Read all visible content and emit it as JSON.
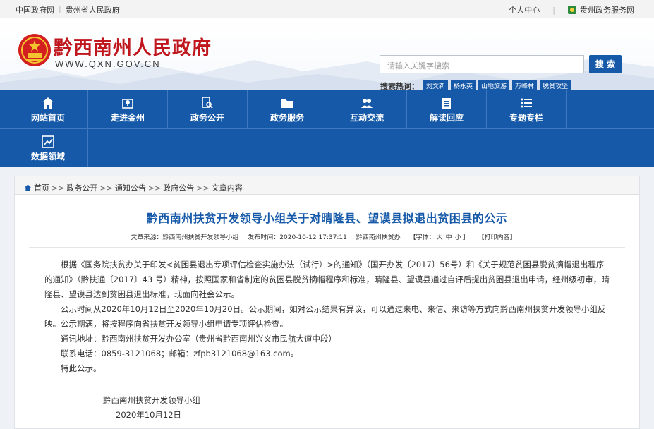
{
  "topbar": {
    "left_links": [
      "中国政府网",
      "贵州省人民政府"
    ],
    "personal_center": "个人中心",
    "gz_service": "贵州政务服务网"
  },
  "header": {
    "site_title": "黔西南州人民政府",
    "site_url": "WWW.QXN.GOV.CN",
    "search_placeholder": "请输入关键字搜索",
    "search_button": "搜 索",
    "hotwords_label": "搜索热词：",
    "hotwords": [
      "刘文新",
      "杨永英",
      "山地旅游",
      "万峰林",
      "脱贫攻坚"
    ]
  },
  "nav": {
    "items": [
      {
        "label": "网站首页",
        "icon": "home-icon"
      },
      {
        "label": "走进金州",
        "icon": "map-pin-icon"
      },
      {
        "label": "政务公开",
        "icon": "document-search-icon"
      },
      {
        "label": "政务服务",
        "icon": "folder-icon"
      },
      {
        "label": "互动交流",
        "icon": "people-icon"
      },
      {
        "label": "解读回应",
        "icon": "clipboard-icon"
      },
      {
        "label": "专题专栏",
        "icon": "list-icon"
      },
      {
        "label": "数据领域",
        "icon": "chart-icon"
      }
    ]
  },
  "breadcrumb": {
    "items": [
      "首页",
      "政务公开",
      "通知公告",
      "政府公告",
      "文章内容"
    ],
    "sep": ">>"
  },
  "article": {
    "title": "黔西南州扶贫开发领导小组关于对晴隆县、望谟县拟退出贫困县的公示",
    "meta_source": "文章来源：黔西南州扶贫开发领导小组",
    "meta_time": "发布时间：2020-10-12 17:37:11",
    "meta_author": "黔西南州扶贫办",
    "meta_font_prefix": "【字体：",
    "meta_font_sizes": [
      "大",
      "中",
      "小"
    ],
    "meta_font_suffix": "】",
    "meta_print": "【打印内容】",
    "paragraphs": [
      "根据《国务院扶贫办关于印发<贫困县退出专项评估检查实施办法（试行）>的通知》（国开办发〔2017〕56号）和《关于规范贫困县脱贫摘帽退出程序的通知》（黔扶通〔2017〕43 号）精神，按照国家和省制定的贫困县脱贫摘帽程序和标准，晴隆县、望谟县通过自评后提出贫困县退出申请，经州级初审，晴隆县、望谟县达到贫困县退出标准，现面向社会公示。",
      "公示时间从2020年10月12日至2020年10月20日。公示期间，如对公示结果有异议，可以通过来电、来信、来访等方式向黔西南州扶贫开发领导小组反映。公示期满，将按程序向省扶贫开发领导小组申请专项评估检查。",
      "通讯地址：黔西南州扶贫开发办公室（贵州省黔西南州兴义市民航大道中段）",
      "联系电话：0859-3121068；邮箱：zfpb3121068@163.com。",
      "特此公示。"
    ],
    "sign_org": "黔西南州扶贫开发领导小组",
    "sign_date": "2020年10月12日"
  },
  "colors": {
    "brand_blue": "#1659a8",
    "title_red": "#c0161d"
  }
}
